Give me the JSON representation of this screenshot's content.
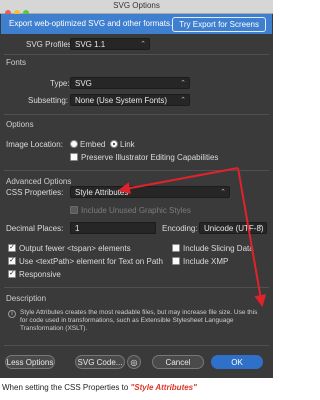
{
  "window": {
    "title": "SVG Options"
  },
  "banner": {
    "text": "Export web-optimized SVG and other formats.",
    "button": "Try Export for Screens"
  },
  "profiles": {
    "label": "SVG Profiles:",
    "value": "SVG 1.1"
  },
  "fonts": {
    "section": "Fonts",
    "type_label": "Type:",
    "type_value": "SVG",
    "subsetting_label": "Subsetting:",
    "subsetting_value": "None (Use System Fonts)"
  },
  "options": {
    "section": "Options",
    "image_location_label": "Image Location:",
    "embed_label": "Embed",
    "link_label": "Link",
    "preserve_label": "Preserve Illustrator Editing Capabilities"
  },
  "advanced": {
    "section": "Advanced Options",
    "css_label": "CSS Properties:",
    "css_value": "Style Attributes",
    "unused_styles_label": "Include Unused Graphic Styles",
    "decimal_label": "Decimal Places:",
    "decimal_value": "1",
    "encoding_label": "Encoding:",
    "encoding_value": "Unicode (UTF-8)",
    "tspan_label": "Output fewer <tspan> elements",
    "textpath_label": "Use <textPath> element for Text on Path",
    "responsive_label": "Responsive",
    "slicing_label": "Include Slicing Data",
    "xmp_label": "Include XMP"
  },
  "description": {
    "section": "Description",
    "text": "Style Attributes creates the most readable files, but may increase file size. Use this for code used in transformations, such as Extensible Stylesheet Language Transformation (XSLT)."
  },
  "buttons": {
    "less": "Less Options",
    "code": "SVG Code...",
    "cancel": "Cancel",
    "ok": "OK"
  },
  "caption": {
    "prefix": "When setting the CSS Properties to ",
    "emphasis": "\"Style Attributes\""
  },
  "colors": {
    "accent": "#3f7fcf",
    "arrow": "#e0232a",
    "panel": "#3a3a3a"
  }
}
